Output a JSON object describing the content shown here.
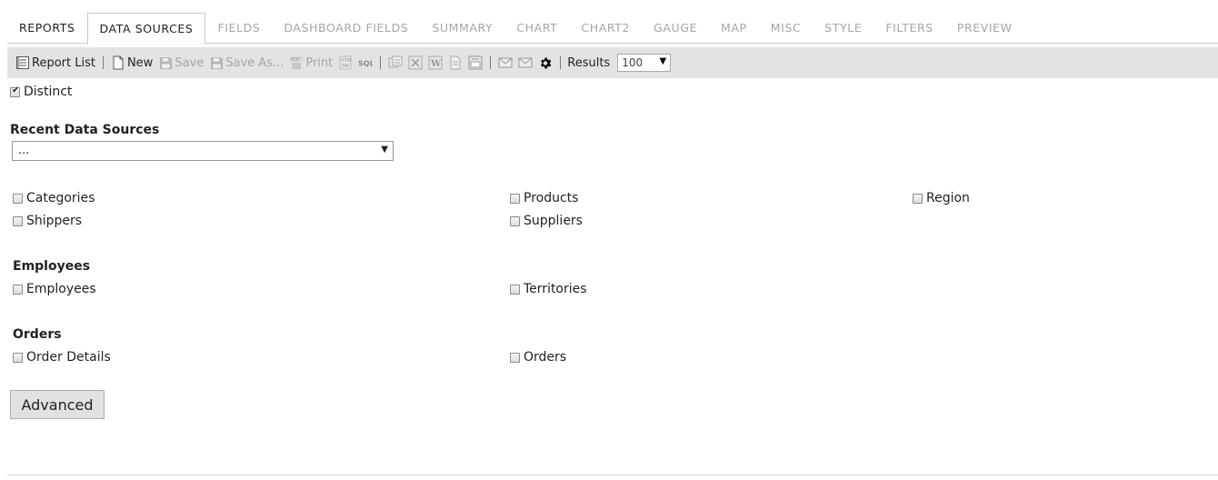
{
  "tabs": [
    {
      "label": "REPORTS"
    },
    {
      "label": "DATA SOURCES"
    },
    {
      "label": "FIELDS"
    },
    {
      "label": "DASHBOARD FIELDS"
    },
    {
      "label": "SUMMARY"
    },
    {
      "label": "CHART"
    },
    {
      "label": "CHART2"
    },
    {
      "label": "GAUGE"
    },
    {
      "label": "MAP"
    },
    {
      "label": "MISC"
    },
    {
      "label": "STYLE"
    },
    {
      "label": "FILTERS"
    },
    {
      "label": "PREVIEW"
    }
  ],
  "toolbar": {
    "report_list": "Report List",
    "new": "New",
    "save": "Save",
    "save_as": "Save As...",
    "print": "Print",
    "sql": "SQL",
    "results_label": "Results",
    "results_value": "100"
  },
  "distinct": {
    "label": "Distinct",
    "checked": true
  },
  "recent": {
    "title": "Recent Data Sources",
    "value": "..."
  },
  "ungrouped": {
    "categories": "Categories",
    "products": "Products",
    "region": "Region",
    "shippers": "Shippers",
    "suppliers": "Suppliers"
  },
  "groups": {
    "employees": {
      "title": "Employees",
      "employees": "Employees",
      "territories": "Territories"
    },
    "orders": {
      "title": "Orders",
      "order_details": "Order Details",
      "orders": "Orders"
    }
  },
  "advanced": "Advanced"
}
